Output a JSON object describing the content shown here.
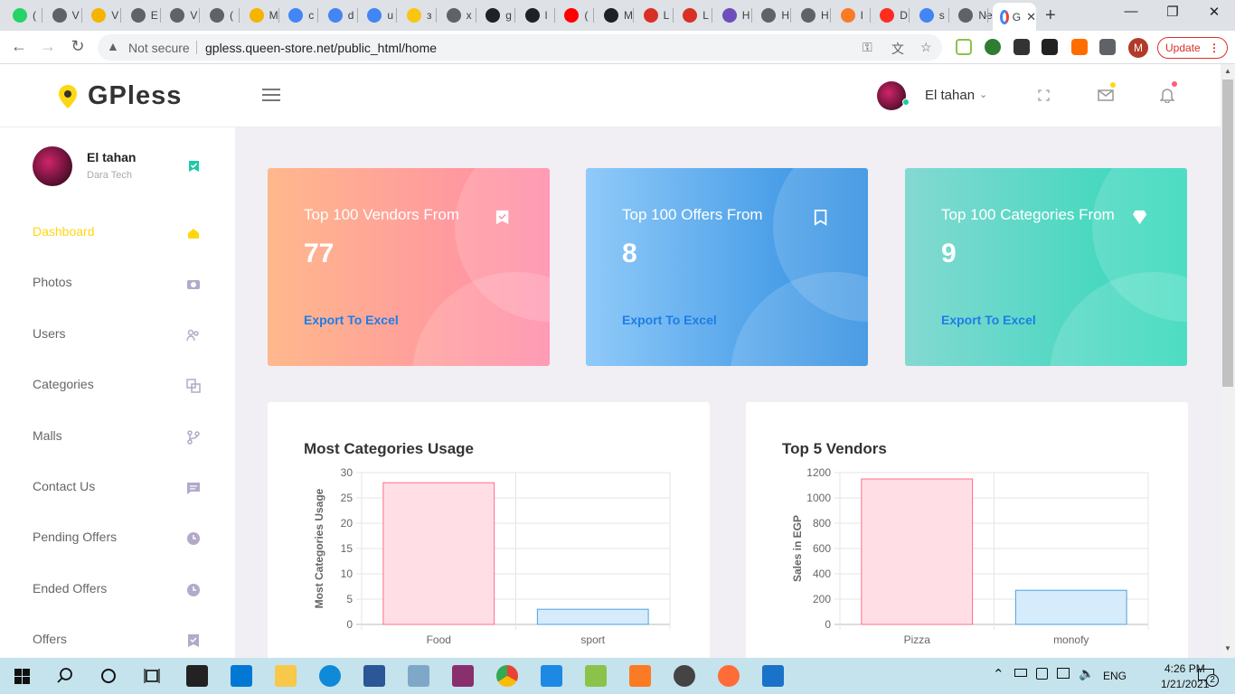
{
  "browser": {
    "tabs": [
      {
        "icon": "whatsapp-icon",
        "color": "#25d366",
        "label": "("
      },
      {
        "icon": "globe-icon",
        "color": "#5f6368",
        "label": "V"
      },
      {
        "icon": "drive-icon",
        "color": "#f4b400",
        "label": "V"
      },
      {
        "icon": "globe-icon",
        "color": "#5f6368",
        "label": "E"
      },
      {
        "icon": "globe-icon",
        "color": "#5f6368",
        "label": "V"
      },
      {
        "icon": "globe-icon",
        "color": "#5f6368",
        "label": "("
      },
      {
        "icon": "drive-icon",
        "color": "#f4b400",
        "label": "M"
      },
      {
        "icon": "docs-icon",
        "color": "#4285f4",
        "label": "c"
      },
      {
        "icon": "docs-icon",
        "color": "#4285f4",
        "label": "d"
      },
      {
        "icon": "docs-icon",
        "color": "#4285f4",
        "label": "u"
      },
      {
        "icon": "tool-icon",
        "color": "#f9c513",
        "label": "з"
      },
      {
        "icon": "globe-icon",
        "color": "#5f6368",
        "label": "x"
      },
      {
        "icon": "github-icon",
        "color": "#202124",
        "label": "g"
      },
      {
        "icon": "moon-icon",
        "color": "#202124",
        "label": "l"
      },
      {
        "icon": "youtube-icon",
        "color": "#ff0000",
        "label": "("
      },
      {
        "icon": "github-icon",
        "color": "#202124",
        "label": "M"
      },
      {
        "icon": "globe-icon",
        "color": "#d93025",
        "label": "L"
      },
      {
        "icon": "globe-icon",
        "color": "#d93025",
        "label": "L"
      },
      {
        "icon": "heroku-icon",
        "color": "#6c4fbb",
        "label": "H"
      },
      {
        "icon": "globe-icon",
        "color": "#5f6368",
        "label": "H"
      },
      {
        "icon": "globe-icon",
        "color": "#5f6368",
        "label": "H"
      },
      {
        "icon": "xampp-icon",
        "color": "#fb7a24",
        "label": "I"
      },
      {
        "icon": "laravel-icon",
        "color": "#ff2d20",
        "label": "D"
      },
      {
        "icon": "google-icon",
        "color": "#4285f4",
        "label": "s"
      },
      {
        "icon": "newtab-icon",
        "color": "#5f6368",
        "label": "New"
      }
    ],
    "active_tab_label": "G",
    "new_tab_label": "+",
    "security_label": "Not secure",
    "url": "gpless.queen-store.net/public_html/home",
    "profile_letter": "M",
    "update_label": "Update"
  },
  "app": {
    "logo_text": "GPless",
    "header": {
      "user_name": "El tahan"
    },
    "sidebar": {
      "user_name": "El tahan",
      "user_subtitle": "Dara Tech",
      "items": [
        {
          "label": "Dashboard",
          "icon": "home-icon",
          "active": true
        },
        {
          "label": "Photos",
          "icon": "camera-icon",
          "active": false
        },
        {
          "label": "Users",
          "icon": "users-icon",
          "active": false
        },
        {
          "label": "Categories",
          "icon": "copy-icon",
          "active": false
        },
        {
          "label": "Malls",
          "icon": "branch-icon",
          "active": false
        },
        {
          "label": "Contact Us",
          "icon": "message-icon",
          "active": false
        },
        {
          "label": "Pending Offers",
          "icon": "clock-icon",
          "active": false
        },
        {
          "label": "Ended Offers",
          "icon": "clock-icon",
          "active": false
        },
        {
          "label": "Offers",
          "icon": "bookmark-check-icon",
          "active": false
        }
      ]
    },
    "cards": [
      {
        "title": "Top 100 Vendors From",
        "value": "77",
        "link": "Export To Excel",
        "icon": "bookmark-check-icon",
        "grad_from": "#ffb88c",
        "grad_to": "#ff8aa8"
      },
      {
        "title": "Top 100 Offers From",
        "value": "8",
        "link": "Export To Excel",
        "icon": "bookmark-icon",
        "grad_from": "#90caf9",
        "grad_to": "#2a8be0"
      },
      {
        "title": "Top 100 Categories From",
        "value": "9",
        "link": "Export To Excel",
        "icon": "diamond-icon",
        "grad_from": "#84d9d2",
        "grad_to": "#2dd7b8"
      }
    ],
    "accent_color": "#fed713"
  },
  "taskbar": {
    "language": "ENG",
    "time": "4:26 PM",
    "date": "1/21/2021",
    "notification_count": "2"
  },
  "chart_data": [
    {
      "type": "bar",
      "title": "Most Categories Usage",
      "ylabel": "Most Categories Usage",
      "categories": [
        "Food",
        "sport"
      ],
      "values": [
        28,
        3
      ],
      "ylim": [
        0,
        30
      ],
      "yticks": [
        0,
        5,
        10,
        15,
        20,
        25,
        30
      ],
      "colors": [
        [
          "#ffdfe5",
          "#ff6b8a"
        ],
        [
          "#d6ebfb",
          "#4aa3e0"
        ]
      ],
      "grid": true
    },
    {
      "type": "bar",
      "title": "Top 5 Vendors",
      "ylabel": "Sales in EGP",
      "categories": [
        "Pizza",
        "monofy"
      ],
      "values": [
        1150,
        270
      ],
      "ylim": [
        0,
        1200
      ],
      "yticks": [
        0,
        200,
        400,
        600,
        800,
        1000,
        1200
      ],
      "colors": [
        [
          "#ffdfe5",
          "#ff6b8a"
        ],
        [
          "#d6ebfb",
          "#4aa3e0"
        ]
      ],
      "grid": true
    }
  ]
}
